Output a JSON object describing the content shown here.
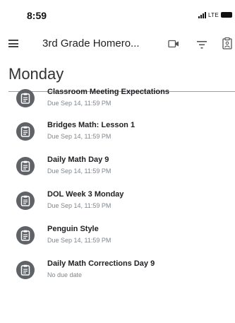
{
  "status_bar": {
    "time": "8:59",
    "network": "LTE"
  },
  "app_bar": {
    "title": "3rd Grade Homero..."
  },
  "section": {
    "title": "Monday"
  },
  "assignments": [
    {
      "title": "Classroom Meeting Expectations",
      "due": "Due Sep 14, 11:59 PM"
    },
    {
      "title": "Bridges Math: Lesson 1",
      "due": "Due Sep 14, 11:59 PM"
    },
    {
      "title": "Daily Math Day 9",
      "due": "Due Sep 14, 11:59 PM"
    },
    {
      "title": "DOL Week 3 Monday",
      "due": "Due Sep 14, 11:59 PM"
    },
    {
      "title": "Penguin Style",
      "due": "Due Sep 14, 11:59 PM"
    },
    {
      "title": "Daily Math Corrections Day 9",
      "due": "No due date"
    }
  ],
  "icons": {
    "menu": "menu-icon",
    "video": "video-icon",
    "filter": "filter-icon",
    "folder": "folder-icon",
    "assignment": "assignment-icon"
  },
  "colors": {
    "assignment_icon_bg": "#5f6368",
    "due_text": "#80868b"
  }
}
